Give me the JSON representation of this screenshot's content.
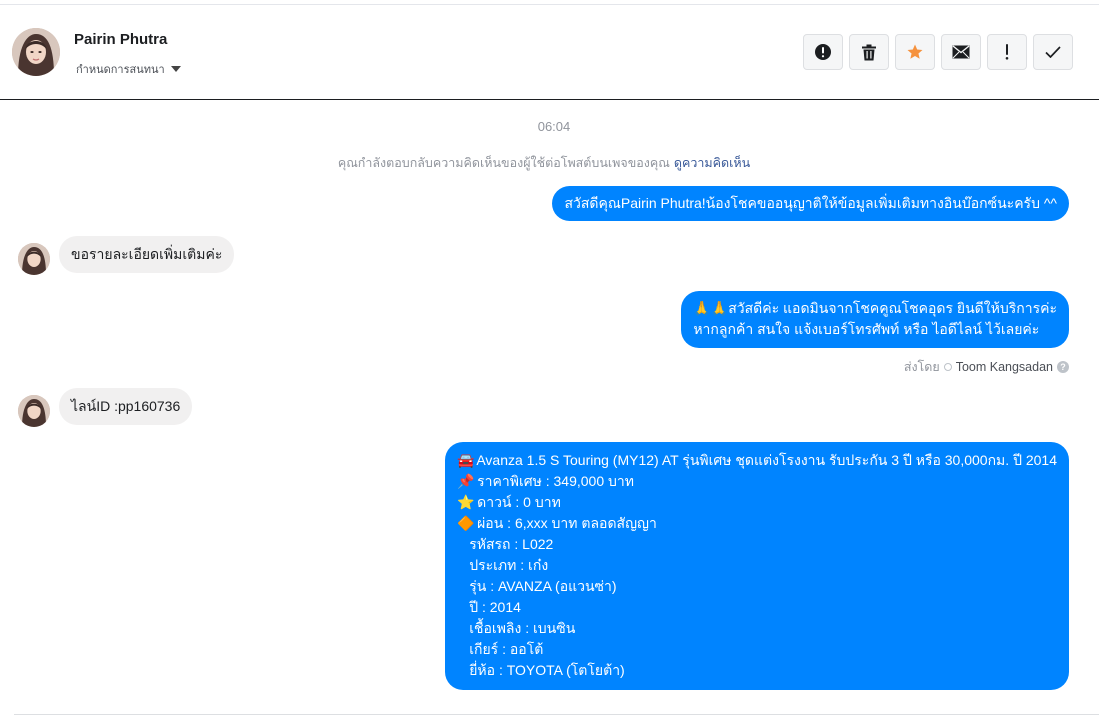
{
  "contact": {
    "name": "Pairin Phutra",
    "assign_label": "กำหนดการสนทนา"
  },
  "toolbar": {
    "buttons": [
      {
        "name": "report-spam-button",
        "icon": "alert-circle-icon"
      },
      {
        "name": "delete-button",
        "icon": "trash-icon"
      },
      {
        "name": "star-button",
        "icon": "star-icon"
      },
      {
        "name": "mark-unread-button",
        "icon": "envelope-icon"
      },
      {
        "name": "follow-up-button",
        "icon": "exclamation-icon"
      },
      {
        "name": "mark-done-button",
        "icon": "check-icon"
      }
    ],
    "star_color": "#f5923e"
  },
  "conversation": {
    "timestamp": "06:04",
    "notice_text": "คุณกำลังตอบกลับความคิดเห็นของผู้ใช้ต่อโพสต์บนเพจของคุณ",
    "notice_link": "ดูความคิดเห็น",
    "messages": [
      {
        "dir": "out",
        "text": "สวัสดีคุณPairin Phutra!น้องโชคขออนุญาติให้ข้อมูลเพิ่มเติมทางอินบ๊อกซ์นะครับ ^^"
      },
      {
        "dir": "in",
        "text": "ขอรายละเอียดเพิ่มเติมค่ะ"
      },
      {
        "dir": "out",
        "lines": [
          "🙏🙏สวัสดีค่ะ แอดมินจากโชคคูณโชคอุดร ยินดีให้บริการค่ะ",
          "หากลูกค้า สนใจ แจ้งเบอร์โทรศัพท์ หรือ ไอดีไลน์  ไว้เลยค่ะ"
        ]
      },
      {
        "dir": "in",
        "text": "ไลน์ID :pp160736"
      },
      {
        "dir": "out",
        "lines": [
          "Avanza 1.5 S Touring (MY12) AT รุ่นพิเศษ ชุดแต่งโรงงาน รับประกัน 3 ปี หรือ 30,000กม. ปี 2014",
          "ราคาพิเศษ : 349,000 บาท",
          "ดาวน์ : 0 บาท",
          " ผ่อน : 6,xxx บาท ตลอดสัญญา",
          "รหัสรถ : L022",
          "ประเภท : เก๋ง",
          "รุ่น : AVANZA (อแวนซ่า)",
          "ปี : 2014",
          "เชื้อเพลิง : เบนซิน",
          "เกียร์ : ออโต้",
          "ยี่ห้อ : TOYOTA (โตโยต้า)"
        ]
      }
    ],
    "sent_by_label": "ส่งโดย",
    "sent_by_name": "Toom Kangsadan",
    "emojis": {
      "car": "🚘",
      "pin": "📌",
      "star": "⭐",
      "diamond": "🔶"
    }
  },
  "colors": {
    "bubble_out": "#0084ff",
    "bubble_in": "#f1f0f0"
  }
}
